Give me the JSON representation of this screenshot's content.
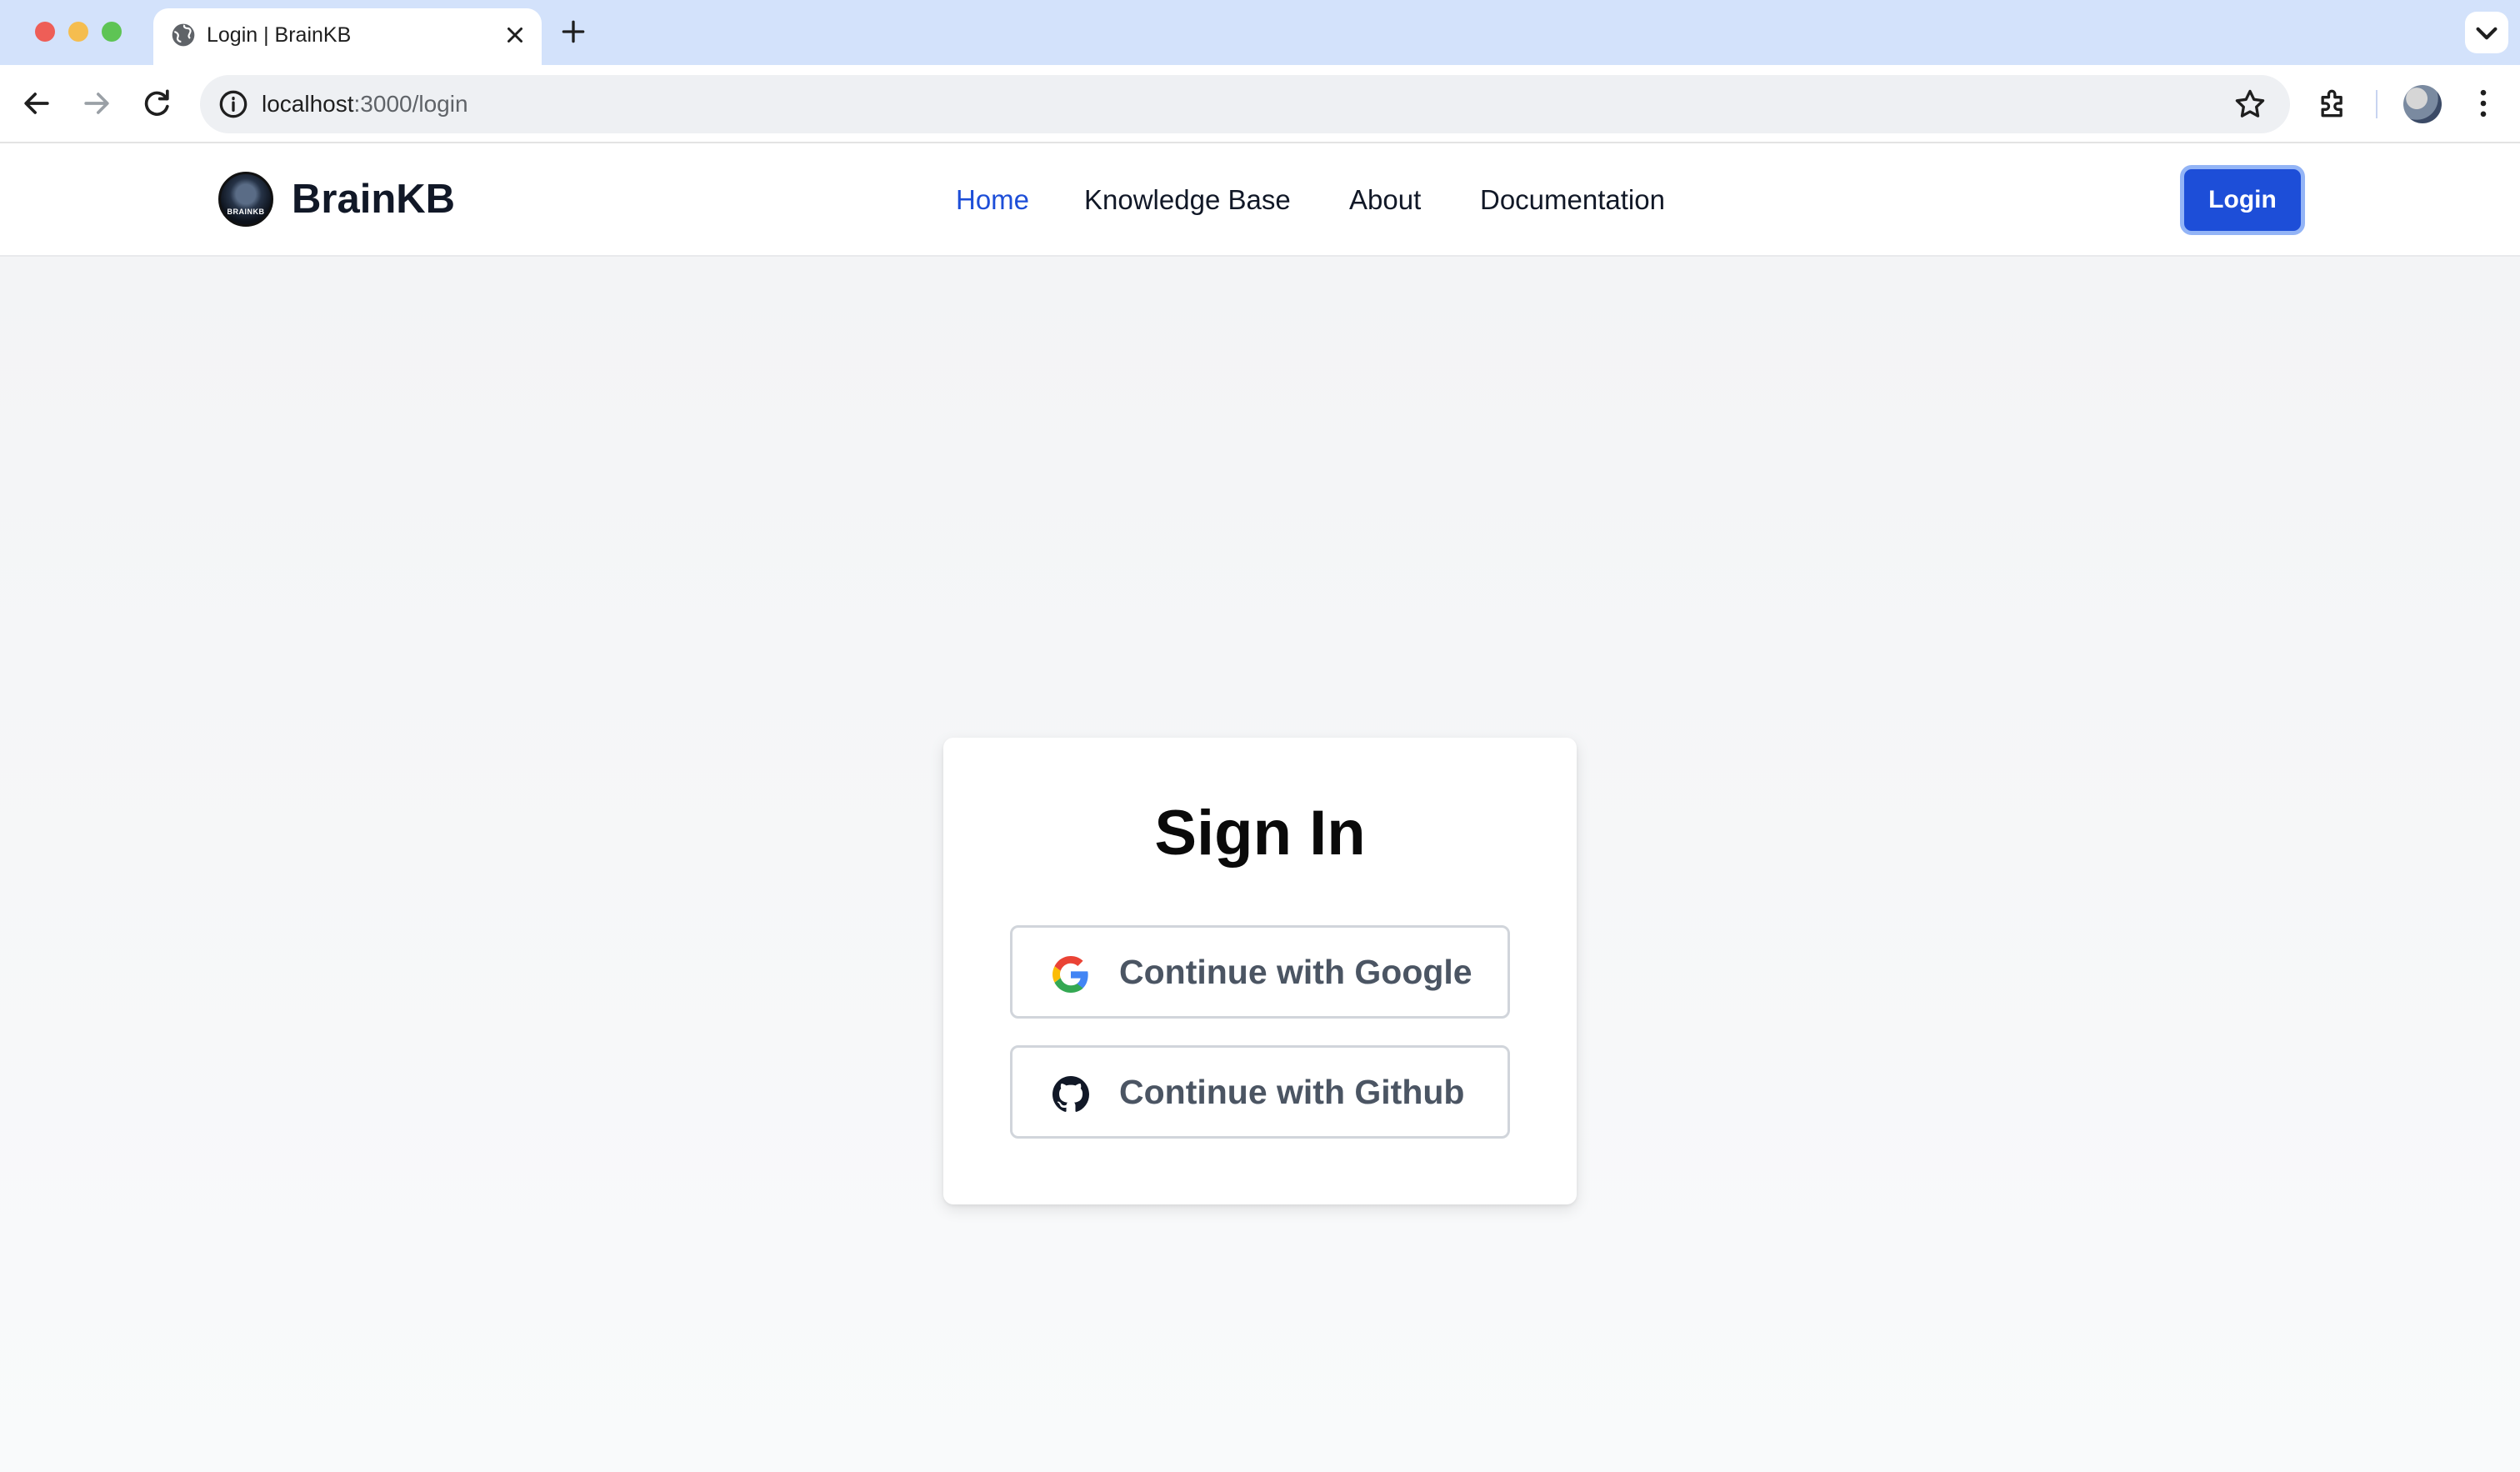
{
  "browser": {
    "tab_title": "Login | BrainKB",
    "url_host": "localhost",
    "url_path": ":3000/login"
  },
  "site": {
    "brand": "BrainKB",
    "logo_text": "BRAINKB",
    "nav": [
      {
        "label": "Home",
        "active": true
      },
      {
        "label": "Knowledge Base",
        "active": false
      },
      {
        "label": "About",
        "active": false
      },
      {
        "label": "Documentation",
        "active": false
      }
    ],
    "login_label": "Login",
    "accent_color": "#1d4ed8"
  },
  "signin": {
    "title": "Sign In",
    "google_label": "Continue with Google",
    "github_label": "Continue with Github"
  },
  "icons": {
    "tab_favicon": "globe-icon",
    "google": "google-icon",
    "github": "github-icon"
  }
}
